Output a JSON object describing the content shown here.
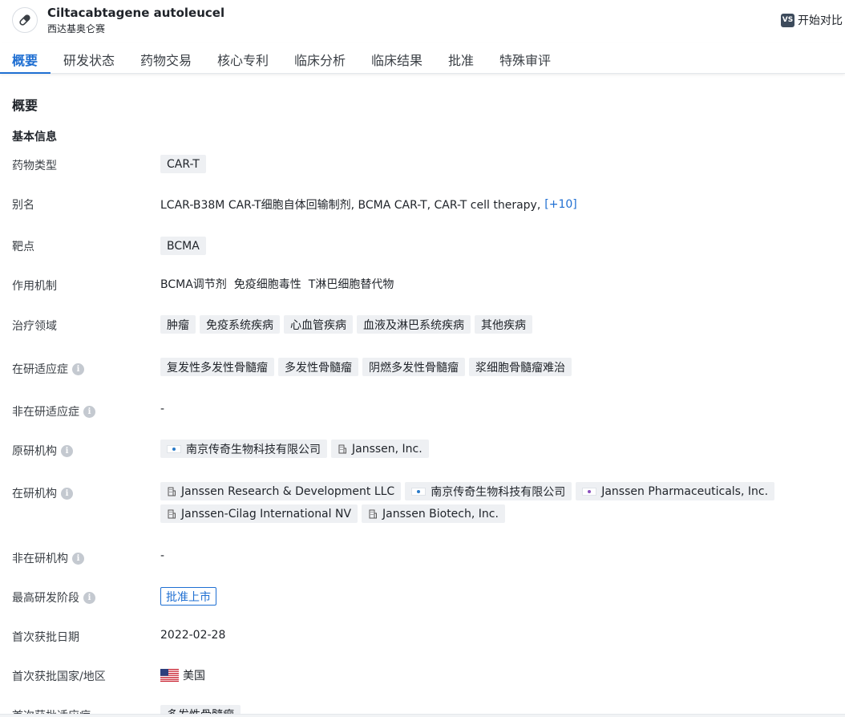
{
  "header": {
    "drug_name": "Ciltacabtagene autoleucel",
    "drug_subname": "西达基奥仑赛",
    "compare_badge": "VS",
    "compare_label": "开始对比"
  },
  "tabs": [
    {
      "label": "概要",
      "active": true
    },
    {
      "label": "研发状态",
      "active": false
    },
    {
      "label": "药物交易",
      "active": false
    },
    {
      "label": "核心专利",
      "active": false
    },
    {
      "label": "临床分析",
      "active": false
    },
    {
      "label": "临床结果",
      "active": false
    },
    {
      "label": "批准",
      "active": false
    },
    {
      "label": "特殊审评",
      "active": false
    }
  ],
  "overview": {
    "section_title": "概要",
    "subsection_title": "基本信息",
    "info_glyph": "i",
    "rows": {
      "drug_type": {
        "label": "药物类型",
        "chips": [
          "CAR-T"
        ]
      },
      "alias": {
        "label": "别名",
        "text": "LCAR-B38M CAR-T细胞自体回输制剂,  BCMA CAR-T,  CAR-T cell therapy,",
        "more": "[+10]"
      },
      "target": {
        "label": "靶点",
        "chips": [
          "BCMA"
        ]
      },
      "mechanism": {
        "label": "作用机制",
        "items": [
          "BCMA调节剂",
          "免疫细胞毒性",
          "T淋巴细胞替代物"
        ]
      },
      "therapeutic_area": {
        "label": "治疗领域",
        "chips": [
          "肿瘤",
          "免疫系统疾病",
          "心血管疾病",
          "血液及淋巴系统疾病",
          "其他疾病"
        ]
      },
      "active_indication": {
        "label": "在研适应症",
        "chips": [
          "复发性多发性骨髓瘤",
          "多发性骨髓瘤",
          "阴燃多发性骨髓瘤",
          "浆细胞骨髓瘤难治"
        ]
      },
      "inactive_indication": {
        "label": "非在研适应症",
        "text": "-"
      },
      "originator": {
        "label": "原研机构",
        "orgs": [
          {
            "name": "南京传奇生物科技有限公司",
            "logo": "legend-logo"
          },
          {
            "name": "Janssen, Inc.",
            "logo": "building-icon"
          }
        ]
      },
      "active_orgs": {
        "label": "在研机构",
        "orgs_line1": [
          {
            "name": "Janssen Research & Development LLC",
            "logo": "building-icon"
          },
          {
            "name": "南京传奇生物科技有限公司",
            "logo": "legend-logo"
          },
          {
            "name": "Janssen Pharmaceuticals, Inc.",
            "logo": "janssen-logo"
          }
        ],
        "orgs_line2": [
          {
            "name": "Janssen-Cilag International NV",
            "logo": "building-icon"
          },
          {
            "name": "Janssen Biotech, Inc.",
            "logo": "building-icon"
          }
        ]
      },
      "inactive_orgs": {
        "label": "非在研机构",
        "text": "-"
      },
      "highest_phase": {
        "label": "最高研发阶段",
        "badge": "批准上市"
      },
      "first_approval_date": {
        "label": "首次获批日期",
        "text": "2022-02-28"
      },
      "first_approval_country": {
        "label": "首次获批国家/地区",
        "text": "美国",
        "flag": "us-flag-icon"
      },
      "first_approval_indication": {
        "label": "首次获批适应症",
        "chip": "多发性骨髓瘤"
      }
    }
  },
  "colors": {
    "accent": "#1f6fd2",
    "chip_bg": "#eef0f3",
    "text": "#1f2329"
  }
}
